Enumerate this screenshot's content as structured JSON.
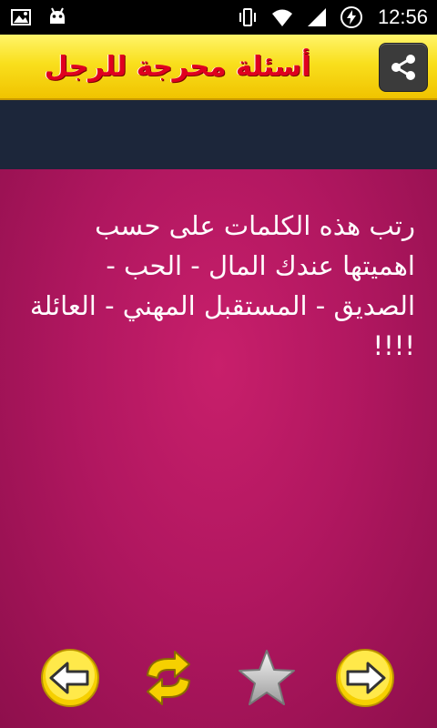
{
  "status_bar": {
    "time": "12:56",
    "icons": [
      "image-icon",
      "android-debug-icon",
      "vibrate-icon",
      "wifi-icon",
      "signal-icon",
      "battery-charging-icon"
    ]
  },
  "header": {
    "title": "أسئلة محرجة للرجل",
    "share_icon": "share-icon"
  },
  "question": {
    "text": "رتب هذه الكلمات على حسب اهميتها عندك المال - الحب - الصديق - المستقبل المهني - العائلة !!!!"
  },
  "bottom_nav": {
    "icons": [
      "arrow-left-icon",
      "refresh-icon",
      "star-icon",
      "arrow-right-icon"
    ]
  },
  "colors": {
    "header_yellow": "#f9df1d",
    "title_red": "#e0001f",
    "background_magenta": "#b0195e",
    "banner_navy": "#1c263a"
  }
}
